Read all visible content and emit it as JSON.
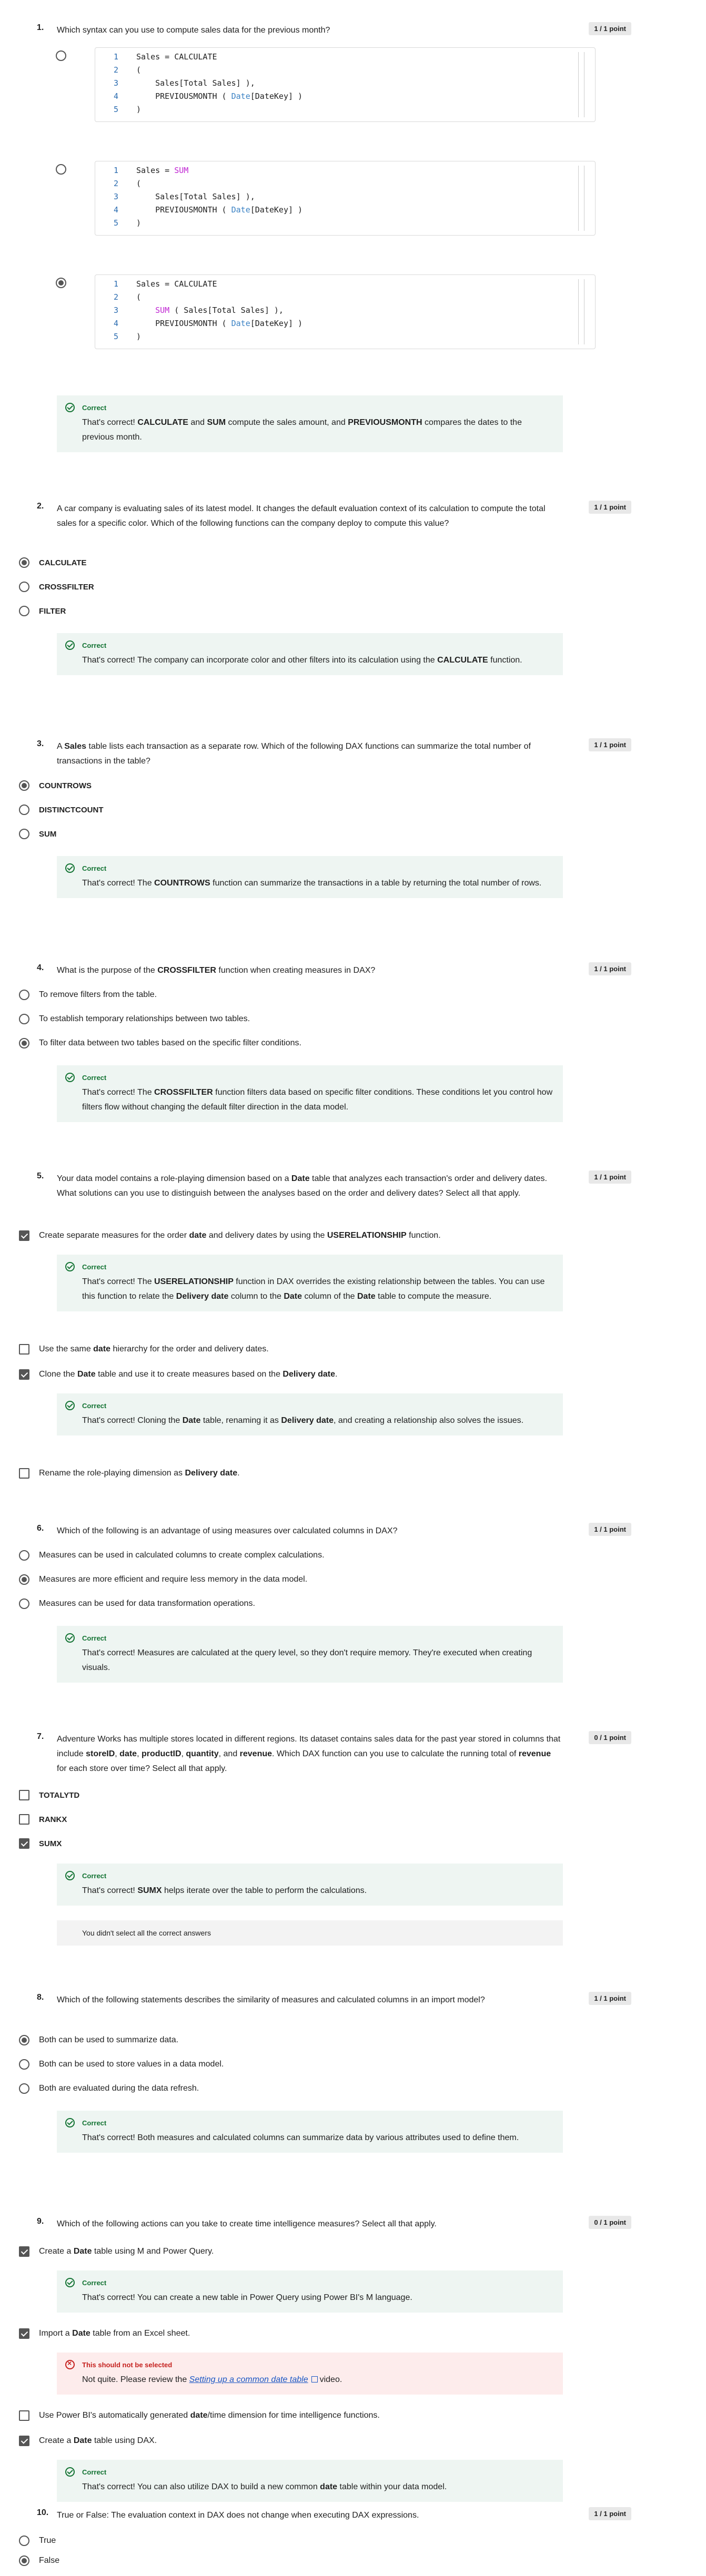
{
  "questions": [
    {
      "num": "1.",
      "text": "Which syntax can you use to compute sales data for the previous month?",
      "points": "1 / 1 point",
      "code_options": [
        {
          "lines": [
            "Sales = CALCULATE",
            "(",
            "    Sales[Total Sales] ),",
            "    PREVIOUSMONTH ( Date[DateKey] )",
            ")"
          ],
          "selected": false
        },
        {
          "lines": [
            "Sales = SUM",
            "(",
            "    Sales[Total Sales] ),",
            "    PREVIOUSMONTH ( Date[DateKey] )",
            ")"
          ],
          "selected": false
        },
        {
          "lines": [
            "Sales = CALCULATE",
            "(",
            "    SUM ( Sales[Total Sales] ),",
            "    PREVIOUSMONTH ( Date[DateKey] )",
            ")"
          ],
          "selected": true
        }
      ],
      "feedback": {
        "title": "Correct",
        "text": "That's correct! CALCULATE and SUM compute the sales amount, and PREVIOUSMONTH compares the dates to the previous month."
      }
    },
    {
      "num": "2.",
      "text": "A car company is evaluating sales of its latest model. It changes the default evaluation context of its calculation to compute the total sales for a specific color. Which of the following functions can the company deploy to compute this value?",
      "points": "1 / 1 point",
      "options": [
        "CALCULATE",
        "CROSSFILTER",
        "FILTER"
      ],
      "feedback": {
        "title": "Correct",
        "text": "That's correct! The company can incorporate color and other filters into its calculation using the CALCULATE function."
      }
    },
    {
      "num": "3.",
      "text": "A Sales table lists each transaction as a separate row. Which of the following DAX functions can summarize the total number of transactions in the table?",
      "points": "1 / 1 point",
      "options": [
        "COUNTROWS",
        "DISTINCTCOUNT",
        "SUM"
      ],
      "feedback": {
        "title": "Correct",
        "text": "That's correct! The COUNTROWS function can summarize the transactions in a table by returning the total number of rows."
      }
    },
    {
      "num": "4.",
      "text": "What is the purpose of the CROSSFILTER function when creating measures in DAX?",
      "points": "1 / 1 point",
      "options": [
        "To remove filters from the table.",
        "To establish temporary relationships between two tables.",
        "To filter data between two tables based on the specific filter conditions."
      ],
      "feedback": {
        "title": "Correct",
        "text": "That's correct! The CROSSFILTER function filters data based on specific filter conditions. These conditions let you control how filters flow without changing the default filter direction in the data model."
      }
    },
    {
      "num": "5.",
      "text": "Your data model contains a role-playing dimension based on a Date table that analyzes each transaction's order and delivery dates. What solutions can you use to distinguish between the analyses based on the order and delivery dates? Select all that apply.",
      "points": "1 / 1 point",
      "options": [
        "Create separate measures for the order date and delivery dates by using the USERELATIONSHIP function.",
        "Use the same date hierarchy for the order and delivery dates.",
        "Clone the Date table and use it to create measures based on the Delivery date.",
        "Rename the role-playing dimension as Delivery date."
      ],
      "feedbacks": [
        {
          "title": "Correct",
          "text": "That's correct! The USERELATIONSHIP function in DAX overrides the existing relationship between the tables. You can use this function to relate the Delivery date column to the Date column of the Date table to compute the measure."
        },
        {
          "title": "Correct",
          "text": "That's correct! Cloning the Date table, renaming it as Delivery date, and creating a relationship also solves the issues."
        }
      ]
    },
    {
      "num": "6.",
      "text": "Which of the following is an advantage of using measures over calculated columns in DAX?",
      "points": "1 / 1 point",
      "options": [
        "Measures can be used in calculated columns to create complex calculations.",
        "Measures are more efficient and require less memory in the data model.",
        "Measures can be used for data transformation operations."
      ],
      "feedback": {
        "title": "Correct",
        "text": "That's correct! Measures are calculated at the query level, so they don't require memory. They're executed when creating visuals."
      }
    },
    {
      "num": "7.",
      "text": "Adventure Works has multiple stores located in different regions. Its dataset contains sales data for the past year stored in columns that include storeID, date, productID, quantity, and revenue. Which DAX function can you use to calculate the running total of revenue for each store over time? Select all that apply.",
      "points": "0 / 1 point",
      "options": [
        "TOTALYTD",
        "RANKX",
        "SUMX"
      ],
      "feedback": {
        "title": "Correct",
        "text": "That's correct! SUMX helps iterate over the table to perform the calculations."
      },
      "note": "You didn't select all the correct answers"
    },
    {
      "num": "8.",
      "text": "Which of the following statements describes the similarity of measures and calculated columns in an import model?",
      "points": "1 / 1 point",
      "options": [
        "Both can be used to summarize data.",
        "Both can be used to store values in a data model.",
        "Both are evaluated during the data refresh."
      ],
      "feedback": {
        "title": "Correct",
        "text": "That's correct! Both measures and calculated columns can summarize data by various attributes used to define them."
      }
    },
    {
      "num": "9.",
      "text": "Which of the following actions can you take to create time intelligence measures? Select all that apply.",
      "points": "0 / 1 point",
      "options": [
        "Create a Date table using M and Power Query.",
        "Import a Date table from an Excel sheet.",
        "Use Power BI's automatically generated date/time dimension for time intelligence functions.",
        "Create a Date table using DAX."
      ],
      "feedbacks": [
        {
          "title": "Correct",
          "text": "That's correct! You can create a new table in Power Query using Power BI's M language."
        },
        {
          "title": "This should not be selected",
          "text_pre": "Not quite. Please review the",
          "link": "Setting up a common date table",
          "text_post": "video."
        },
        {
          "title": "Correct",
          "text": "That's correct! You can also utilize DAX to build a new common date table within your data model."
        }
      ]
    },
    {
      "num": "10.",
      "text": "True or False: The evaluation context in DAX does not change when executing DAX expressions.",
      "points": "1 / 1 point",
      "options": [
        "True",
        "False"
      ]
    }
  ]
}
